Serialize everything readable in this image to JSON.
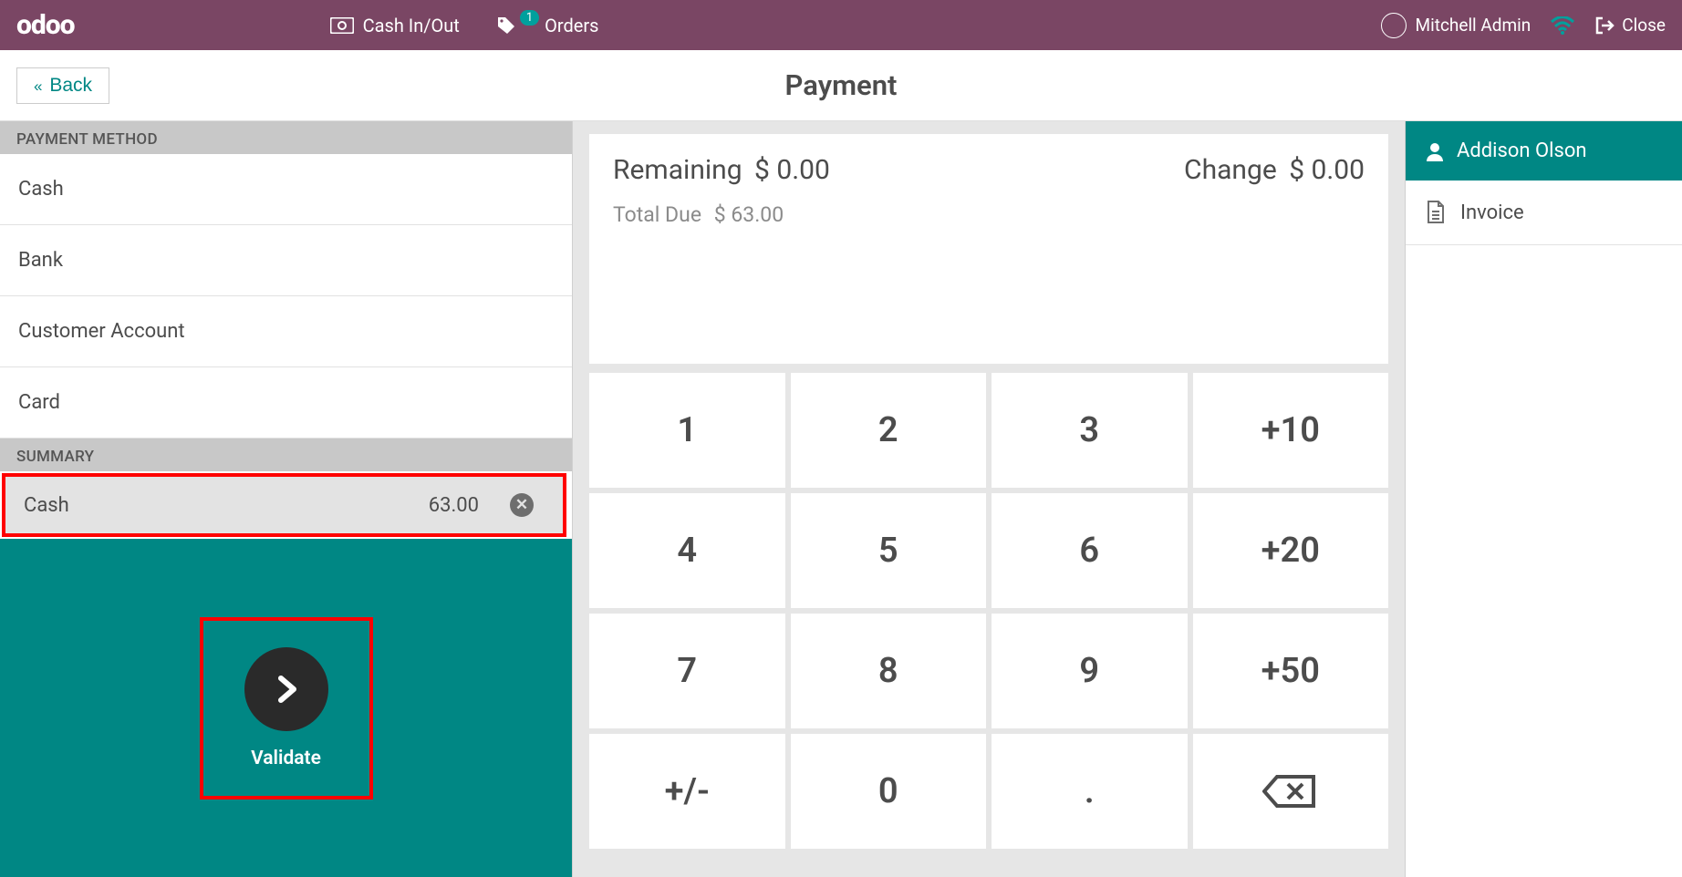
{
  "header": {
    "logo": "odoo",
    "nav": {
      "cash": "Cash In/Out",
      "orders": "Orders",
      "orders_badge": "1"
    },
    "user": "Mitchell Admin",
    "close": "Close"
  },
  "page": {
    "back": "Back",
    "title": "Payment"
  },
  "methods": {
    "heading": "PAYMENT METHOD",
    "items": [
      {
        "label": "Cash"
      },
      {
        "label": "Bank"
      },
      {
        "label": "Customer Account"
      },
      {
        "label": "Card"
      }
    ]
  },
  "summary": {
    "heading": "SUMMARY",
    "line": {
      "label": "Cash",
      "amount": "63.00"
    }
  },
  "validate": {
    "label": "Validate"
  },
  "info": {
    "remaining_label": "Remaining",
    "remaining_value": "$ 0.00",
    "change_label": "Change",
    "change_value": "$ 0.00",
    "due_label": "Total Due",
    "due_value": "$ 63.00"
  },
  "keypad": {
    "keys": [
      "1",
      "2",
      "3",
      "+10",
      "4",
      "5",
      "6",
      "+20",
      "7",
      "8",
      "9",
      "+50",
      "+/-",
      "0",
      ".",
      "⌫"
    ]
  },
  "right": {
    "customer": "Addison Olson",
    "invoice": "Invoice"
  }
}
